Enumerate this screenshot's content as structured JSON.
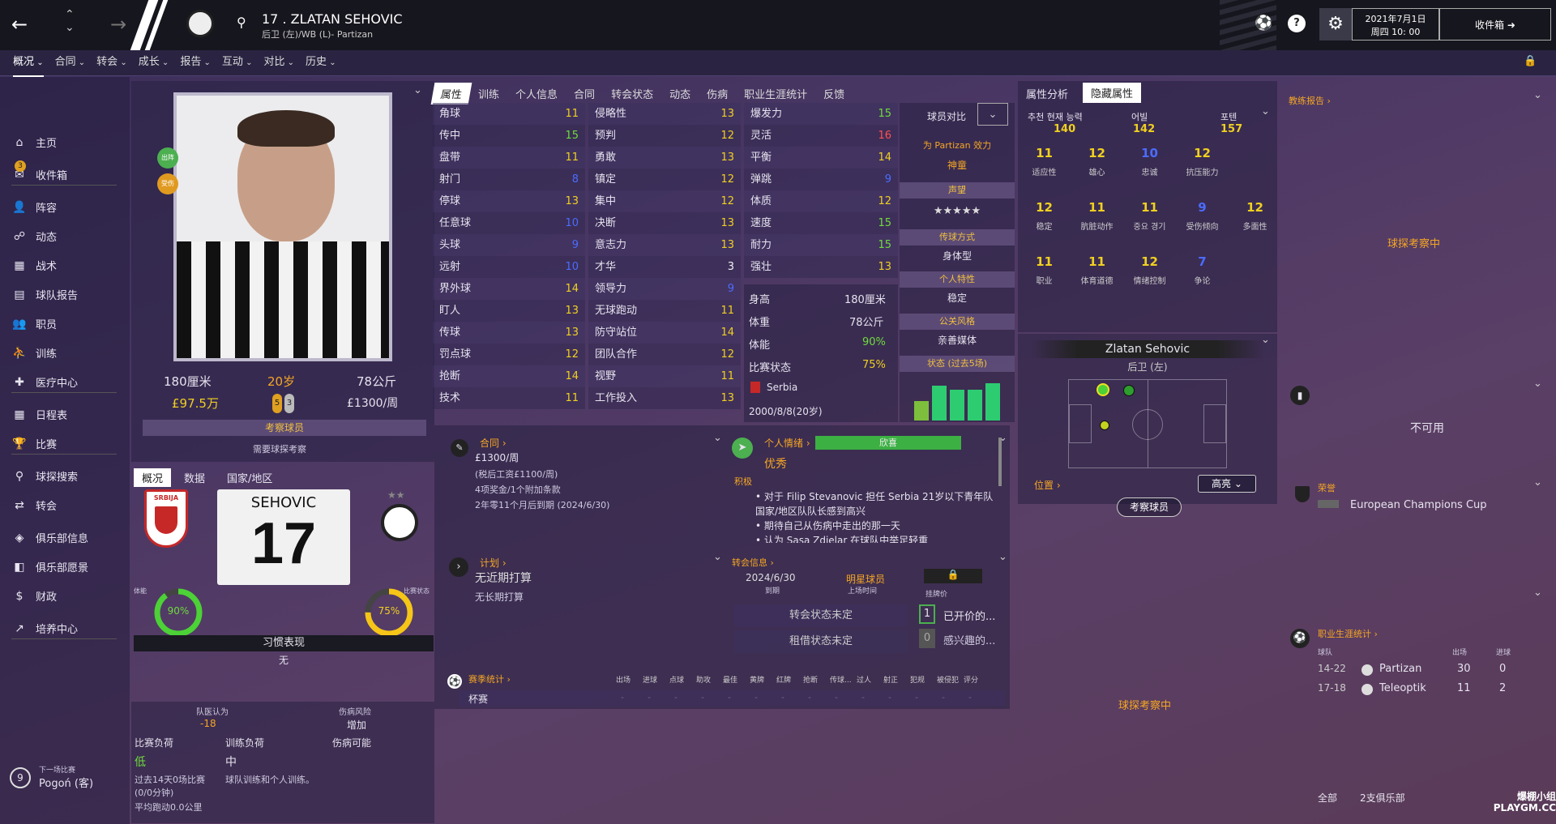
{
  "header": {
    "player_title": "17 . ZLATAN SEHOVIC",
    "player_sub": "后卫 (左)/WB (L)- Partizan",
    "date_line1": "2021年7月1日",
    "date_line2": "周四 10: 00",
    "inbox_label": "收件箱"
  },
  "subnav": [
    "概况",
    "合同",
    "转会",
    "成长",
    "报告",
    "互动",
    "对比",
    "历史"
  ],
  "sidebar": [
    {
      "label": "主页",
      "icon": "home-icon"
    },
    {
      "label": "收件箱",
      "icon": "inbox-icon",
      "badge": "3"
    },
    {
      "label": "阵容",
      "icon": "squad-icon"
    },
    {
      "label": "动态",
      "icon": "dynamics-icon"
    },
    {
      "label": "战术",
      "icon": "tactics-icon"
    },
    {
      "label": "球队报告",
      "icon": "report-icon"
    },
    {
      "label": "职员",
      "icon": "staff-icon"
    },
    {
      "label": "训练",
      "icon": "training-icon"
    },
    {
      "label": "医疗中心",
      "icon": "medical-icon"
    },
    {
      "label": "日程表",
      "icon": "calendar-icon"
    },
    {
      "label": "比赛",
      "icon": "trophy-icon"
    },
    {
      "label": "球探搜索",
      "icon": "search-icon"
    },
    {
      "label": "转会",
      "icon": "transfer-icon"
    },
    {
      "label": "俱乐部信息",
      "icon": "club-icon"
    },
    {
      "label": "俱乐部愿景",
      "icon": "vision-icon"
    },
    {
      "label": "财政",
      "icon": "finance-icon"
    },
    {
      "label": "培养中心",
      "icon": "development-icon"
    }
  ],
  "next_match": {
    "label": "下一场比赛",
    "number": "9",
    "team": "Pogoń (客)"
  },
  "profile": {
    "height": "180厘米",
    "age": "20岁",
    "weight": "78公斤",
    "value": "£97.5万",
    "wage": "£1300/周",
    "fitness_badge": "出阵",
    "injury_badge": "受伤",
    "footed_left": "5",
    "footed_right": "3",
    "scout_btn": "考察球员",
    "scout_need": "需要球探考察",
    "tabs": [
      "概况",
      "数据",
      "国家/地区"
    ],
    "shirt_name": "SEHOVIC",
    "shirt_number": "17",
    "fitness_label": "体能",
    "fitness_pct": "90%",
    "fitness_val": 0.9,
    "form_label": "比赛状态",
    "form_pct": "75%",
    "form_val": 0.75,
    "habit_title": "习惯表现",
    "habit_val": "无",
    "injury_title_a": "队医认为",
    "injury_a": "-18",
    "injury_title_b": "伤病风险",
    "injury_b": "增加",
    "load_title": "比赛负荷",
    "load_val": "低",
    "train_load_title": "训练负荷",
    "train_load_val": "中",
    "injury_poss_title": "伤病可能",
    "load_desc1": "过去14天0场比赛",
    "load_desc2": "(0/0分钟)",
    "load_desc3": "平均跑动0.0公里",
    "train_desc": "球队训练和个人训练。",
    "serbia_badge": "SRBIJA"
  },
  "attr_tabs": [
    "属性",
    "训练",
    "个人信息",
    "合同",
    "转会状态",
    "动态",
    "伤病",
    "职业生涯统计",
    "反馈"
  ],
  "attr_col1": [
    [
      "角球",
      "11",
      "yel"
    ],
    [
      "传中",
      "15",
      "grn"
    ],
    [
      "盘带",
      "11",
      "yel"
    ],
    [
      "射门",
      "8",
      "blu"
    ],
    [
      "停球",
      "13",
      "yel"
    ],
    [
      "任意球",
      "10",
      "blu"
    ],
    [
      "头球",
      "9",
      "blu"
    ],
    [
      "远射",
      "10",
      "blu"
    ],
    [
      "界外球",
      "14",
      "yel"
    ],
    [
      "盯人",
      "13",
      "yel"
    ],
    [
      "传球",
      "13",
      "yel"
    ],
    [
      "罚点球",
      "12",
      "yel"
    ],
    [
      "抢断",
      "14",
      "yel"
    ],
    [
      "技术",
      "11",
      "yel"
    ]
  ],
  "attr_col2": [
    [
      "侵略性",
      "13",
      "yel"
    ],
    [
      "预判",
      "12",
      "yel"
    ],
    [
      "勇敢",
      "13",
      "yel"
    ],
    [
      "镇定",
      "12",
      "yel"
    ],
    [
      "集中",
      "12",
      "yel"
    ],
    [
      "决断",
      "13",
      "yel"
    ],
    [
      "意志力",
      "13",
      "yel"
    ],
    [
      "才华",
      "3",
      "wht"
    ],
    [
      "领导力",
      "9",
      "blu"
    ],
    [
      "无球跑动",
      "11",
      "yel"
    ],
    [
      "防守站位",
      "14",
      "yel"
    ],
    [
      "团队合作",
      "12",
      "yel"
    ],
    [
      "视野",
      "11",
      "yel"
    ],
    [
      "工作投入",
      "13",
      "yel"
    ]
  ],
  "attr_col3": [
    [
      "爆发力",
      "15",
      "grn"
    ],
    [
      "灵活",
      "16",
      "red"
    ],
    [
      "平衡",
      "14",
      "yel"
    ],
    [
      "弹跳",
      "9",
      "blu"
    ],
    [
      "体质",
      "12",
      "yel"
    ],
    [
      "速度",
      "15",
      "grn"
    ],
    [
      "耐力",
      "15",
      "grn"
    ],
    [
      "强壮",
      "13",
      "yel"
    ]
  ],
  "physical": {
    "height_l": "身高",
    "height_v": "180厘米",
    "weight_l": "体重",
    "weight_v": "78公斤",
    "fit_l": "体能",
    "fit_v": "90%",
    "form_l": "比赛状态",
    "form_v": "75%",
    "nation": "Serbia",
    "dob": "2000/8/8(20岁)"
  },
  "compare": {
    "label": "球员对比",
    "for_club": "为 Partizan 效力",
    "role": "神童",
    "rep_title": "声望",
    "stars": "★★★★★",
    "pos_title": "传球方式",
    "pos_val": "身体型",
    "trait_title": "个人特性",
    "trait_val": "稳定",
    "media_title": "公关风格",
    "media_val": "亲善媒体",
    "form_title": "状态 (过去5场)",
    "form_bars": [
      0.45,
      0.8,
      0.7,
      0.7,
      0.85
    ]
  },
  "contract": {
    "title": "合同",
    "wage": "£1300/周",
    "line1": "(税后工资£1100/周)",
    "line2": "4项奖金/1个附加条款",
    "line3": "2年零11个月后到期 (2024/6/30)"
  },
  "mood": {
    "title": "个人情绪",
    "bar_label": "欣喜",
    "status": "优秀",
    "positive": "积极",
    "b1": "对于 Filip Stevanovic 担任 Serbia 21岁以下青年队 国家/地区队队长感到高兴",
    "b2": "期待自己从伤病中走出的那一天",
    "b3": "认为 Sasa Zdjelar 在球队中举足轻重"
  },
  "plan": {
    "title": "计划",
    "l1": "无近期打算",
    "l2": "无长期打算"
  },
  "transfer": {
    "title": "转会信息",
    "date": "2024/6/30",
    "date_l": "到期",
    "star": "明星球员",
    "star_l": "上场时间",
    "price_l": "挂牌价",
    "status1": "转会状态未定",
    "status2": "租借状态未定",
    "c1": "1",
    "c1_l": "已开价的...",
    "c2": "0",
    "c2_l": "感兴趣的..."
  },
  "season": {
    "title": "赛季统计",
    "cols": [
      "出场",
      "进球",
      "点球",
      "助攻",
      "最佳",
      "黄牌",
      "红牌",
      "抢断",
      "传球...",
      "过人",
      "射正",
      "犯规",
      "被侵犯",
      "评分"
    ],
    "row_l": "杯赛",
    "row_v": "-"
  },
  "hidden": {
    "tab1": "属性分析",
    "tab2": "隐藏属性",
    "h1": "추천 현재 능력",
    "v1": "140",
    "h2": "어빌",
    "v2": "142",
    "h3": "포텐",
    "v3": "157",
    "cells": [
      [
        "11",
        "适应性",
        "yel"
      ],
      [
        "12",
        "雄心",
        "yel"
      ],
      [
        "10",
        "忠诚",
        "blu"
      ],
      [
        "12",
        "抗压能力",
        "yel"
      ],
      [
        "12",
        "稳定",
        "yel"
      ],
      [
        "11",
        "肮脏动作",
        "yel"
      ],
      [
        "11",
        "중요 경기",
        "yel"
      ],
      [
        "9",
        "受伤倾向",
        "blu"
      ],
      [
        "12",
        "多面性",
        "yel"
      ],
      [
        "11",
        "职业",
        "yel"
      ],
      [
        "11",
        "体育道德",
        "yel"
      ],
      [
        "12",
        "情绪控制",
        "yel"
      ],
      [
        "7",
        "争论",
        "blu"
      ]
    ]
  },
  "pitch": {
    "name": "Zlatan Sehovic",
    "pos": "后卫 (左)",
    "pos_link": "位置",
    "btn": "高亮",
    "scout": "考察球员"
  },
  "right": {
    "scout_report": "教练报告",
    "scouting": "球探考察中",
    "na": "不可用",
    "honours": "荣誉",
    "honour_val": "European Champions Cup",
    "career": "职业生涯统计",
    "col_team": "球队",
    "col_apps": "出场",
    "col_goals": "进球",
    "rows": [
      [
        "14-22",
        "Partizan",
        "30",
        "0"
      ],
      [
        "17-18",
        "Teleoptik",
        "11",
        "2"
      ]
    ],
    "footer_all": "全部",
    "footer_clubs": "2支俱乐部",
    "scouting2": "球探考察中"
  },
  "watermark": "爆棚小组 PLAYGM.CC"
}
